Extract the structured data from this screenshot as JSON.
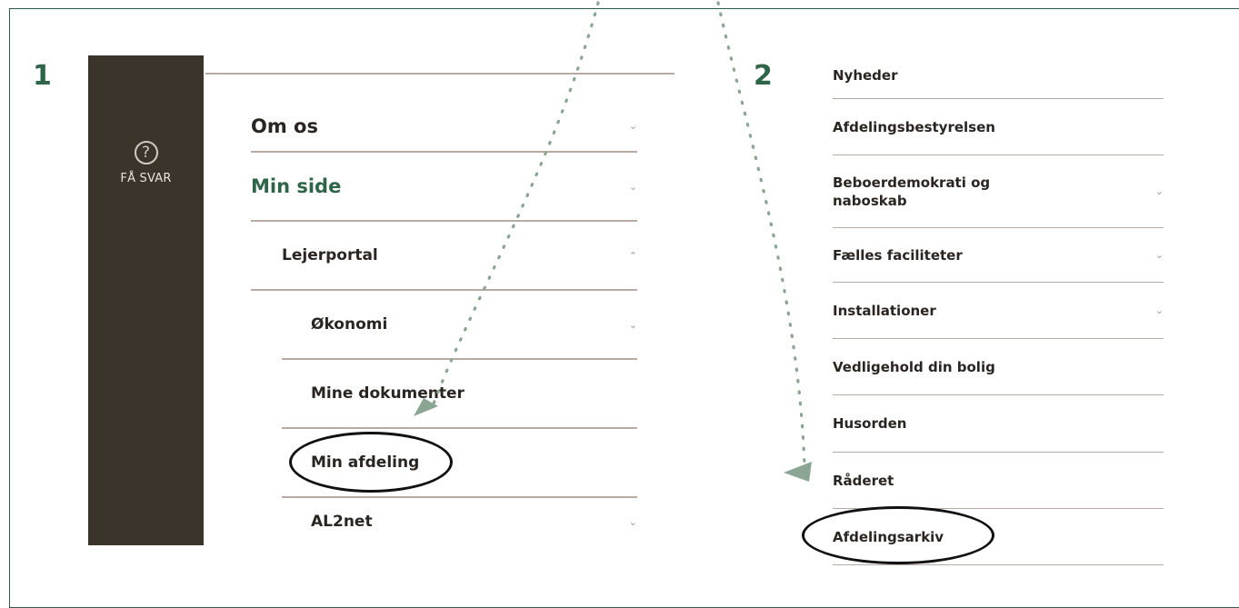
{
  "steps": [
    "1",
    "2"
  ],
  "sidebar": {
    "help_label": "FÅ SVAR",
    "help_icon": "question-circle-icon",
    "help_glyph": "?"
  },
  "menu1": {
    "items": [
      {
        "label": "Om os",
        "chevron": "⌄"
      },
      {
        "label": "Min side",
        "chevron": "⌄",
        "accent": "#2e6548"
      },
      {
        "label": "Lejerportal",
        "chevron": "⌃"
      },
      {
        "label": "Økonomi",
        "chevron": "⌄"
      },
      {
        "label": "Mine dokumenter",
        "chevron": ""
      },
      {
        "label": "Min afdeling",
        "chevron": ""
      },
      {
        "label": "AL2net",
        "chevron": "⌄"
      }
    ]
  },
  "menu2": {
    "items": [
      {
        "label": "Nyheder",
        "chevron": ""
      },
      {
        "label": "Afdelingsbestyrelsen",
        "chevron": ""
      },
      {
        "label": "Beboerdemokrati og naboskab",
        "chevron": "⌄"
      },
      {
        "label": "Fælles faciliteter",
        "chevron": "⌄"
      },
      {
        "label": "Installationer",
        "chevron": "⌄"
      },
      {
        "label": "Vedligehold din bolig",
        "chevron": ""
      },
      {
        "label": "Husorden",
        "chevron": ""
      },
      {
        "label": "Råderet",
        "chevron": ""
      },
      {
        "label": "Afdelingsarkiv",
        "chevron": ""
      }
    ]
  },
  "colors": {
    "accent": "#2e6548",
    "sidebar": "#3a342b",
    "divider": "#b9aba4",
    "arrow": "#8aa692"
  }
}
